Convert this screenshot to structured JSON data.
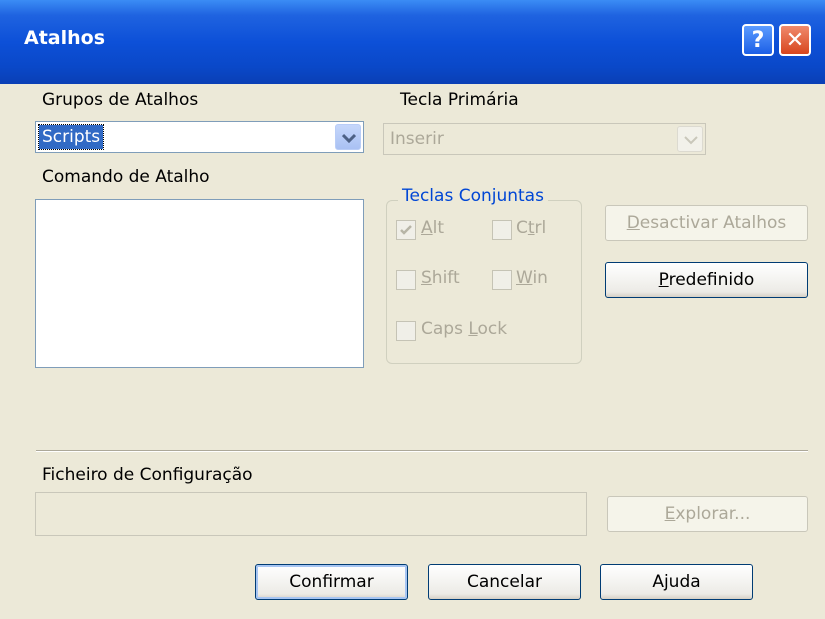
{
  "window": {
    "title": "Atalhos",
    "help_label": "?",
    "close_label": "✕"
  },
  "groups": {
    "label": "Grupos de Atalhos",
    "selected": "Scripts"
  },
  "primary_key": {
    "label": "Tecla Primária",
    "selected": "Inserir"
  },
  "command": {
    "label": "Comando de Atalho"
  },
  "modifiers": {
    "title": "Teclas Conjuntas",
    "alt": {
      "pre": "",
      "key": "A",
      "post": "lt",
      "checked": true
    },
    "ctrl": {
      "pre": "C",
      "key": "t",
      "post": "rl",
      "checked": false
    },
    "shift": {
      "pre": "",
      "key": "S",
      "post": "hift",
      "checked": false
    },
    "win": {
      "pre": "",
      "key": "W",
      "post": "in",
      "checked": false
    },
    "caps": {
      "pre": "Caps ",
      "key": "L",
      "post": "ock",
      "checked": false
    }
  },
  "buttons": {
    "disable": {
      "key": "D",
      "rest": "esactivar Atalhos"
    },
    "default": {
      "key": "P",
      "rest": "redefinido"
    },
    "explore": {
      "key": "E",
      "rest": "xplorar..."
    },
    "confirm": "Confirmar",
    "cancel": "Cancelar",
    "help": "Ajuda"
  },
  "config_file": {
    "label": "Ficheiro de Configuração",
    "value": ""
  },
  "colors": {
    "titlebar": "#0a48c8",
    "window_bg": "#ece9d8",
    "selection": "#316ac5",
    "group_title": "#0046d5"
  },
  "icons": {
    "help": "question-icon",
    "close": "close-icon",
    "dropdown": "chevron-down-icon",
    "check": "check-icon"
  }
}
